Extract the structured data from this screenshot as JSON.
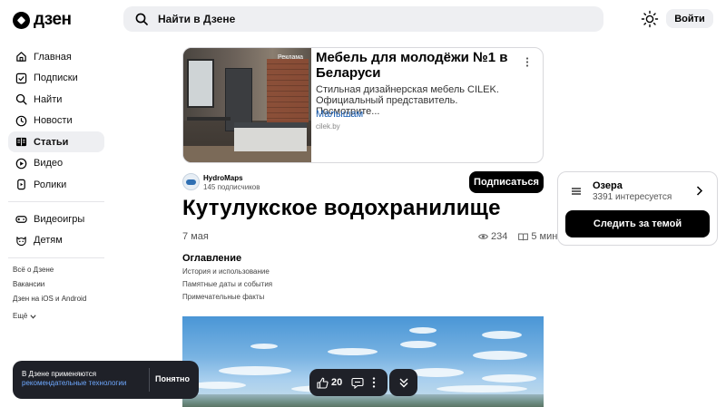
{
  "header": {
    "logo_text": "дзен",
    "search_placeholder": "Найти в Дзене",
    "login_label": "Войти"
  },
  "sidebar": {
    "items": [
      {
        "label": "Главная",
        "icon": "home-icon"
      },
      {
        "label": "Подписки",
        "icon": "subscriptions-icon"
      },
      {
        "label": "Найти",
        "icon": "search-icon"
      },
      {
        "label": "Новости",
        "icon": "news-icon"
      },
      {
        "label": "Статьи",
        "icon": "articles-icon",
        "active": true
      },
      {
        "label": "Видео",
        "icon": "video-icon"
      },
      {
        "label": "Ролики",
        "icon": "shorts-icon"
      }
    ],
    "items2": [
      {
        "label": "Видеоигры",
        "icon": "gamepad-icon"
      },
      {
        "label": "Детям",
        "icon": "kids-icon"
      }
    ],
    "footer": [
      "Всё о Дзене",
      "Вакансии",
      "Дзен на iOS и Android"
    ],
    "more_label": "Ещё"
  },
  "ad": {
    "tag": "Реклама",
    "title": "Мебель для молодёжи №1 в Беларуси",
    "description": "Стильная дизайнерская мебель CILEK. Официальный представитель. Посмотрите...",
    "brand": "Малышам",
    "domain": "cilek.by"
  },
  "channel": {
    "name": "HydroMaps",
    "subscribers": "145 подписчиков",
    "subscribe_label": "Подписаться"
  },
  "article": {
    "title": "Кутулукское водохранилище",
    "date": "7 мая",
    "views": "234",
    "read_time": "5 мин",
    "toc_heading": "Оглавление",
    "toc": [
      "История и использование",
      "Памятные даты и события",
      "Примечательные факты"
    ]
  },
  "topic": {
    "name": "Озера",
    "interested": "3391 интересуется",
    "follow_label": "Следить за темой"
  },
  "cookie": {
    "text": "В Дзене применяются",
    "link": "рекомендательные технологии",
    "button": "Понятно"
  },
  "actions": {
    "likes": "20"
  }
}
